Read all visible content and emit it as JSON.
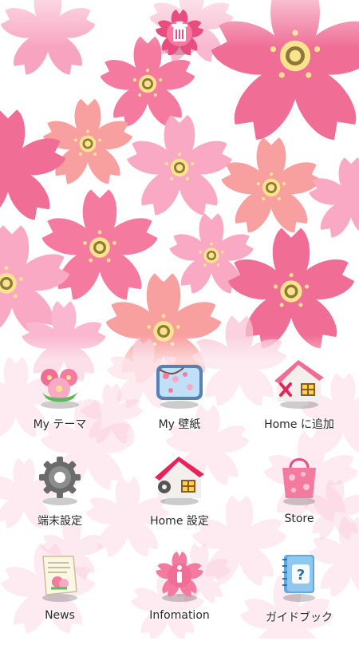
{
  "header": {
    "trash_icon": "trash-icon"
  },
  "menu": {
    "items": [
      {
        "label": "My テーマ",
        "icon": "flower-bouquet-icon"
      },
      {
        "label": "My 壁紙",
        "icon": "wallpaper-picture-icon"
      },
      {
        "label": "Home に追加",
        "icon": "house-add-icon"
      },
      {
        "label": "端末設定",
        "icon": "gear-icon"
      },
      {
        "label": "Home 設定",
        "icon": "house-settings-icon"
      },
      {
        "label": "Store",
        "icon": "shopping-bag-icon"
      },
      {
        "label": "News",
        "icon": "newspaper-icon"
      },
      {
        "label": "Infomation",
        "icon": "info-icon"
      },
      {
        "label": "ガイドブック",
        "icon": "guidebook-icon"
      }
    ]
  },
  "colors": {
    "petal_pink": "#f47aa0",
    "petal_light": "#f9a9c4",
    "petal_salmon": "#f8a0a0",
    "center_yellow": "#fbe38e",
    "accent": "#e84d80"
  }
}
